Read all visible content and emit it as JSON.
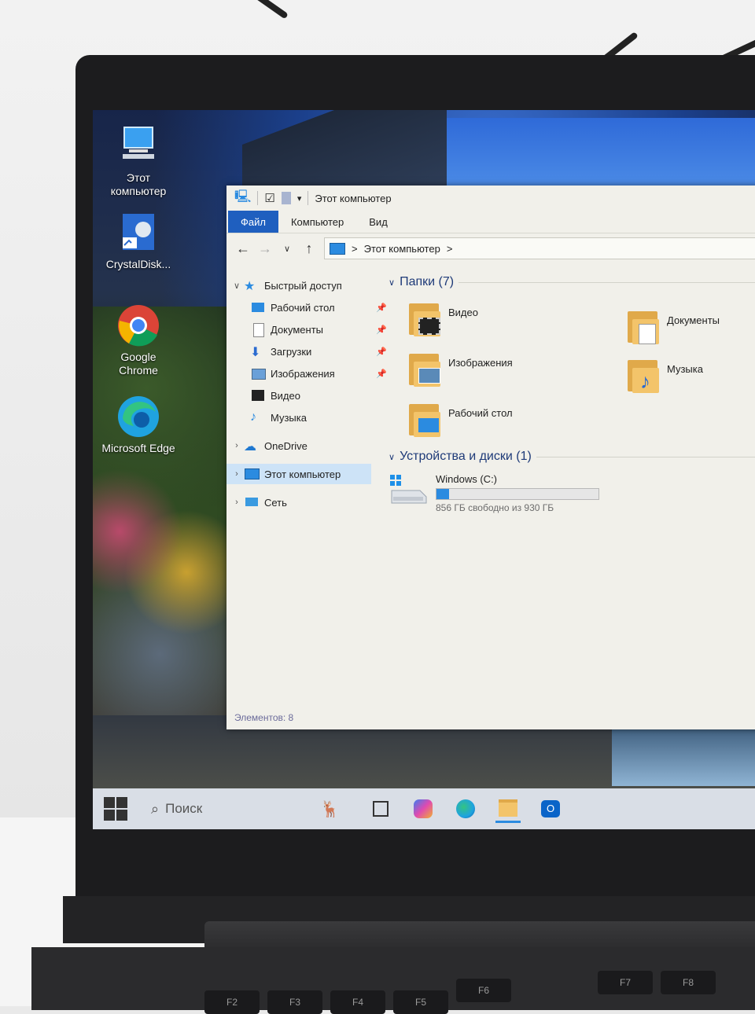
{
  "desktop": {
    "icons": [
      {
        "name": "this-pc",
        "label": "Этот компьютер"
      },
      {
        "name": "crystaldisk",
        "label": "CrystalDisk..."
      },
      {
        "name": "google-chrome",
        "label": "Google Chrome"
      },
      {
        "name": "microsoft-edge",
        "label": "Microsoft Edge"
      }
    ]
  },
  "explorer": {
    "title": "Этот компьютер",
    "ribbon_tabs": [
      "Файл",
      "Компьютер",
      "Вид"
    ],
    "address": {
      "path": "Этот компьютер",
      "separator": ">"
    },
    "nav": {
      "quick_access": "Быстрый доступ",
      "items": [
        {
          "label": "Рабочий стол",
          "pinned": true
        },
        {
          "label": "Документы",
          "pinned": true
        },
        {
          "label": "Загрузки",
          "pinned": true
        },
        {
          "label": "Изображения",
          "pinned": true
        },
        {
          "label": "Видео",
          "pinned": false
        },
        {
          "label": "Музыка",
          "pinned": false
        }
      ],
      "onedrive": "OneDrive",
      "this_pc": "Этот компьютер",
      "network": "Сеть"
    },
    "folders_group": "Папки (7)",
    "folders": [
      {
        "label": "Видео",
        "icon": "video-folder-icon"
      },
      {
        "label": "Документы",
        "icon": "documents-folder-icon"
      },
      {
        "label": "Изображения",
        "icon": "pictures-folder-icon"
      },
      {
        "label": "Музыка",
        "icon": "music-folder-icon"
      },
      {
        "label": "Рабочий стол",
        "icon": "desktop-folder-icon"
      }
    ],
    "drives_group": "Устройства и диски (1)",
    "drive": {
      "label": "Windows (C:)",
      "free_text": "856 ГБ свободно из 930 ГБ",
      "used_fraction": 0.08
    },
    "status": "Элементов: 8"
  },
  "taskbar": {
    "search_placeholder": "Поиск",
    "apps": [
      "task-view-icon",
      "copilot-icon",
      "edge-icon",
      "file-explorer-icon",
      "outlook-icon"
    ]
  },
  "keyboard": {
    "fkeys": [
      "F2",
      "F3",
      "F4",
      "F5",
      "F6",
      "F7",
      "F8"
    ]
  },
  "colors": {
    "accent": "#1f5fbf",
    "selection": "#cde3f7",
    "group_header": "#1e3a78",
    "drive_bar": "#2b8be0"
  }
}
